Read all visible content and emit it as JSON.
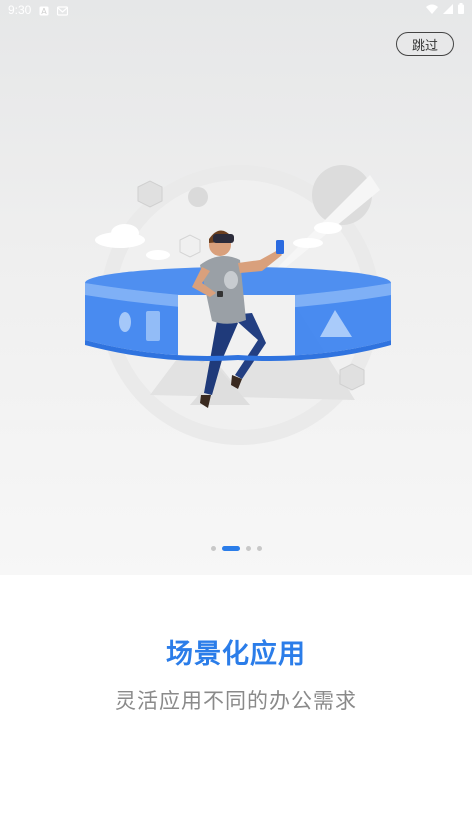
{
  "status_bar": {
    "time": "9:30",
    "left_icons": [
      "a-badge-icon",
      "mail-icon"
    ],
    "right_icons": [
      "wifi-icon",
      "signal-icon",
      "battery-icon"
    ]
  },
  "header": {
    "skip_label": "跳过"
  },
  "pager": {
    "count": 4,
    "active_index": 1
  },
  "content": {
    "title": "场景化应用",
    "subtitle": "灵活应用不同的办公需求"
  },
  "colors": {
    "accent": "#2b7de9",
    "subtitle": "#8a8a8a",
    "dot_inactive": "#c8c8c8"
  }
}
